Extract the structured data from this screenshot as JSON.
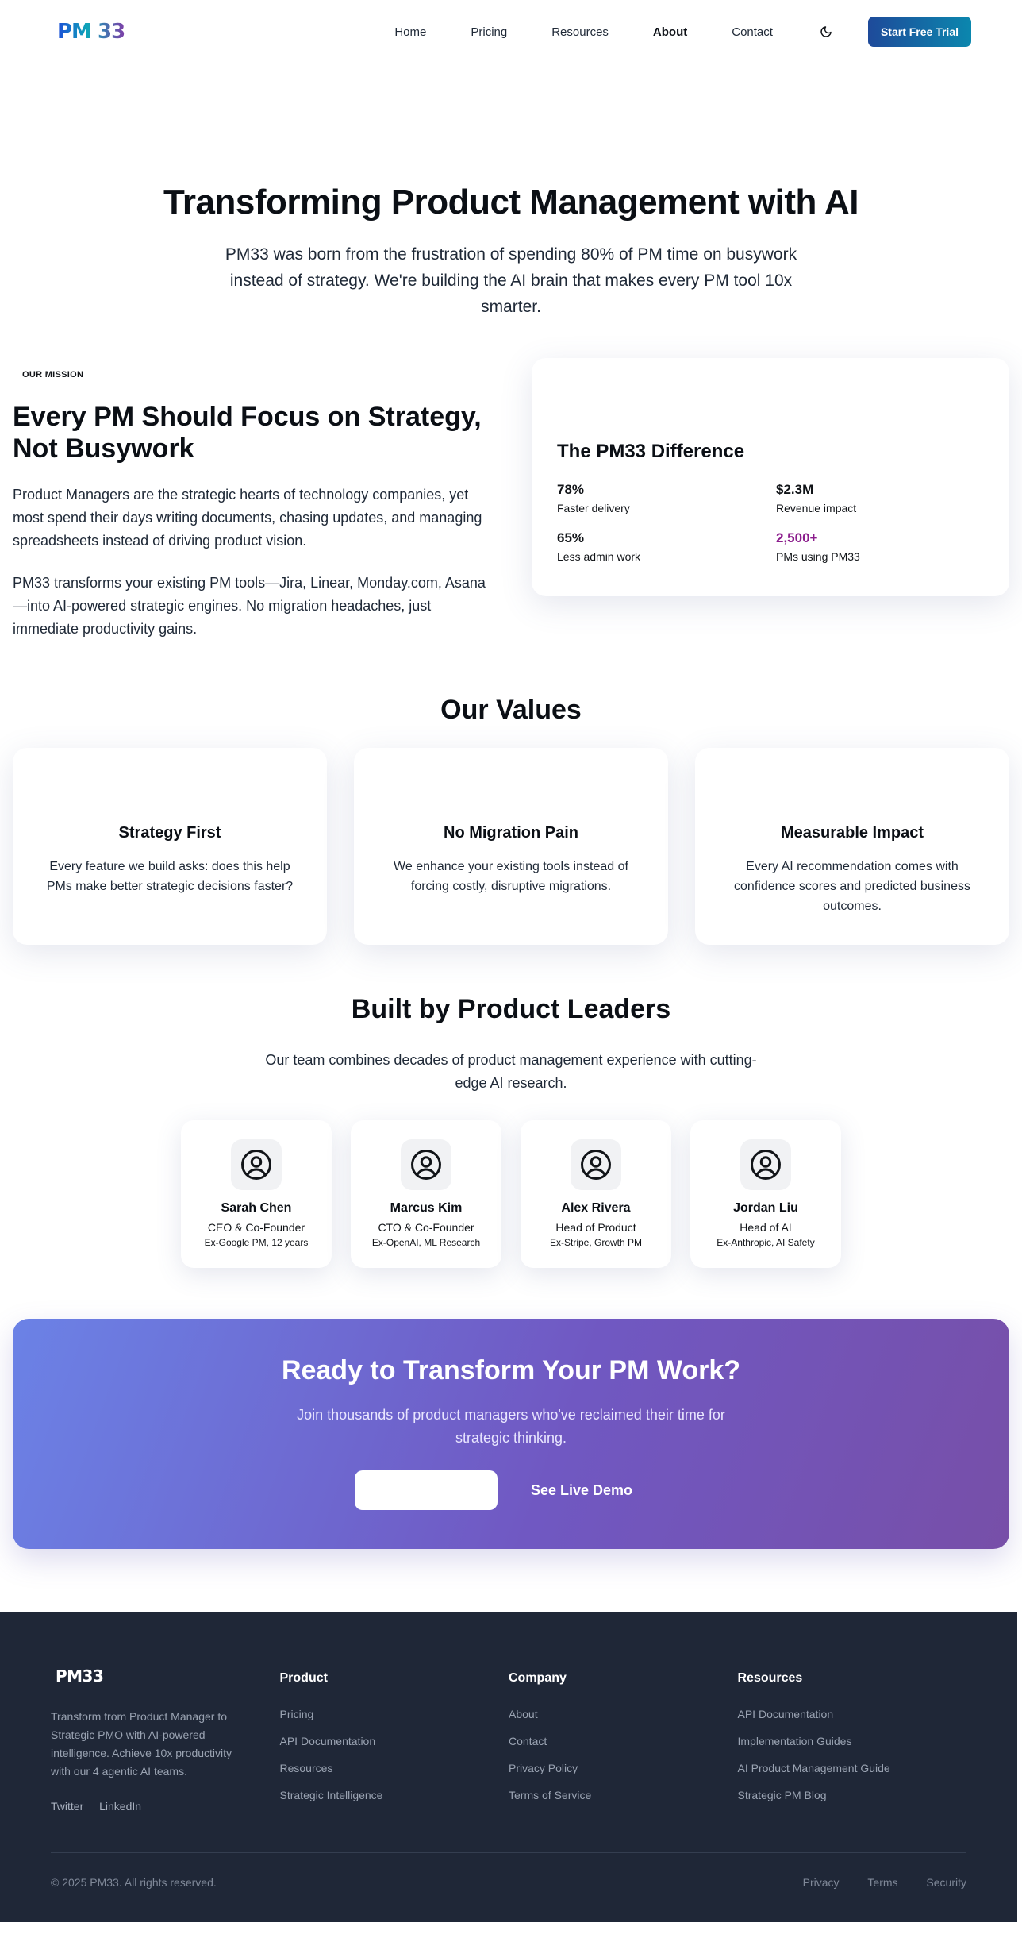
{
  "header": {
    "logo": "PM 33",
    "nav": [
      "Home",
      "Pricing",
      "Resources",
      "About",
      "Contact"
    ],
    "active_nav": "About",
    "theme_icon": "moon-icon",
    "cta_label": "Start Free Trial"
  },
  "hero": {
    "title": "Transforming Product Management with AI",
    "subtitle": "PM33 was born from the frustration of spending 80% of PM time on busywork instead of strategy. We're building the AI brain that makes every PM tool 10x smarter."
  },
  "mission": {
    "eyebrow": "OUR MISSION",
    "heading": "Every PM Should Focus on Strategy, Not Busywork",
    "paragraphs": [
      "Product Managers are the strategic hearts of technology companies, yet most spend their days writing documents, chasing updates, and managing spreadsheets instead of driving product vision.",
      "PM33 transforms your existing PM tools—Jira, Linear, Monday.com, Asana—into AI-powered strategic engines. No migration headaches, just immediate productivity gains."
    ],
    "card": {
      "title": "The PM33 Difference",
      "stats": [
        {
          "value": "78%",
          "label": "Faster delivery"
        },
        {
          "value": "$2.3M",
          "label": "Revenue impact"
        },
        {
          "value": "65%",
          "label": "Less admin work"
        },
        {
          "value": "2,500+",
          "label": "PMs using PM33"
        }
      ]
    }
  },
  "values": {
    "title": "Our Values",
    "items": [
      {
        "title": "Strategy First",
        "text": "Every feature we build asks: does this help PMs make better strategic decisions faster?"
      },
      {
        "title": "No Migration Pain",
        "text": "We enhance your existing tools instead of forcing costly, disruptive migrations."
      },
      {
        "title": "Measurable Impact",
        "text": "Every AI recommendation comes with confidence scores and predicted business outcomes."
      }
    ]
  },
  "team": {
    "title": "Built by Product Leaders",
    "subtitle": "Our team combines decades of product management experience with cutting-edge AI research.",
    "members": [
      {
        "name": "Sarah Chen",
        "role": "CEO & Co-Founder",
        "bio": "Ex-Google PM, 12 years"
      },
      {
        "name": "Marcus Kim",
        "role": "CTO & Co-Founder",
        "bio": "Ex-OpenAI, ML Research"
      },
      {
        "name": "Alex Rivera",
        "role": "Head of Product",
        "bio": "Ex-Stripe, Growth PM"
      },
      {
        "name": "Jordan Liu",
        "role": "Head of AI",
        "bio": "Ex-Anthropic, AI Safety"
      }
    ]
  },
  "cta": {
    "title": "Ready to Transform Your PM Work?",
    "subtitle": "Join thousands of product managers who've reclaimed their time for strategic thinking.",
    "primary_label": "",
    "secondary_label": "See Live Demo"
  },
  "footer": {
    "logo": "PM33",
    "description": "Transform from Product Manager to Strategic PMO with AI-powered intelligence. Achieve 10x productivity with our 4 agentic AI teams.",
    "social": [
      "Twitter",
      "LinkedIn"
    ],
    "columns": [
      {
        "heading": "Product",
        "links": [
          "Pricing",
          "API Documentation",
          "Resources",
          "Strategic Intelligence"
        ]
      },
      {
        "heading": "Company",
        "links": [
          "About",
          "Contact",
          "Privacy Policy",
          "Terms of Service"
        ]
      },
      {
        "heading": "Resources",
        "links": [
          "API Documentation",
          "Implementation Guides",
          "AI Product Management Guide",
          "Strategic PM Blog"
        ]
      }
    ],
    "copyright": "© 2025 PM33. All rights reserved.",
    "legal": [
      "Privacy",
      "Terms",
      "Security"
    ]
  },
  "colors": {
    "brand_gradient_start": "#1e4a9a",
    "brand_gradient_end": "#0b87ae",
    "accent_stat": "#8b1c8c",
    "banner_start": "#6b82e6",
    "banner_end": "#774fa8",
    "footer_bg": "#1f2737"
  }
}
